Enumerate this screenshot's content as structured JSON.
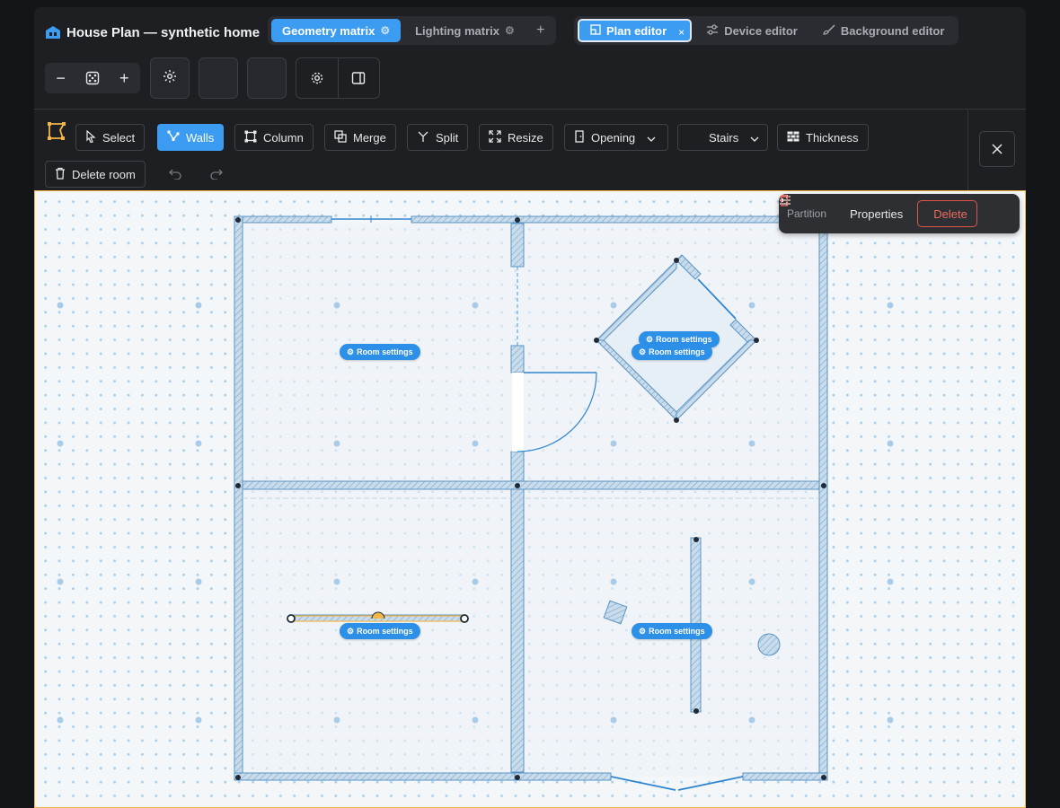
{
  "app_title": "House Plan — synthetic home",
  "left_tabs": [
    {
      "label": "Geometry matrix",
      "active": true,
      "icon": "gear-icon"
    },
    {
      "label": "Lighting matrix",
      "active": false,
      "icon": "gear-icon"
    }
  ],
  "add_tab_symbol": "+",
  "editor_tabs": [
    {
      "label": "Plan editor",
      "active": true,
      "icon": "plan-icon",
      "close": "×"
    },
    {
      "label": "Device editor",
      "active": false,
      "icon": "sliders-icon"
    },
    {
      "label": "Background editor",
      "active": false,
      "icon": "brush-icon"
    }
  ],
  "zoom": {
    "minus": "−",
    "plus": "+"
  },
  "tools": {
    "select": "Select",
    "walls": "Walls",
    "column": "Column",
    "merge": "Merge",
    "split": "Split",
    "resize": "Resize",
    "opening": "Opening",
    "stairs": "Stairs",
    "thickness": "Thickness",
    "delete_room": "Delete room"
  },
  "active_tool": "Walls",
  "canvas": {
    "room_settings_label": "Room settings",
    "room_settings_count": 5
  },
  "popup": {
    "label": "Partition",
    "properties": "Properties",
    "delete": "Delete"
  },
  "colors": {
    "accent": "#3b9cf2",
    "selection_border": "#f2b648",
    "danger": "#ef6b5f",
    "wall_fill": "#c9dcec",
    "wall_stroke": "#4f8fc4"
  }
}
